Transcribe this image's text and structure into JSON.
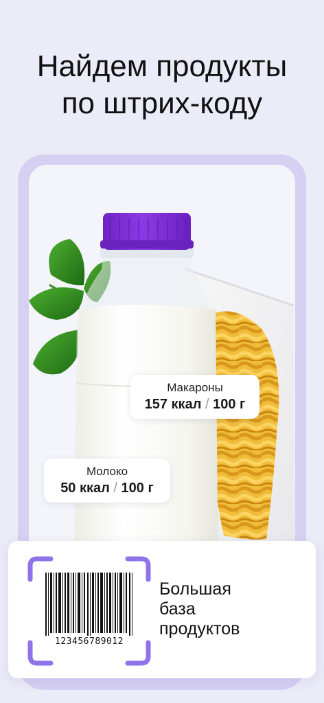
{
  "headline": {
    "line1": "Найдем продукты",
    "line2": "по штрих-коду"
  },
  "products": {
    "pasta": {
      "name": "Макароны",
      "kcal": "157 ккал",
      "separator": "/",
      "unit": "100 г"
    },
    "milk": {
      "name": "Молоко",
      "kcal": "50 ккал",
      "separator": "/",
      "unit": "100 г"
    }
  },
  "scan_panel": {
    "barcode_number": "123456789012",
    "caption": [
      "Большая",
      "база",
      "продуктов"
    ]
  },
  "colors": {
    "background": "#ecebf8",
    "frame": "#d6d1f3",
    "accent_purple": "#8e74e8",
    "cap_purple": "#7d2fd6"
  },
  "icons": [
    "scan-frame-icon",
    "barcode-icon"
  ]
}
